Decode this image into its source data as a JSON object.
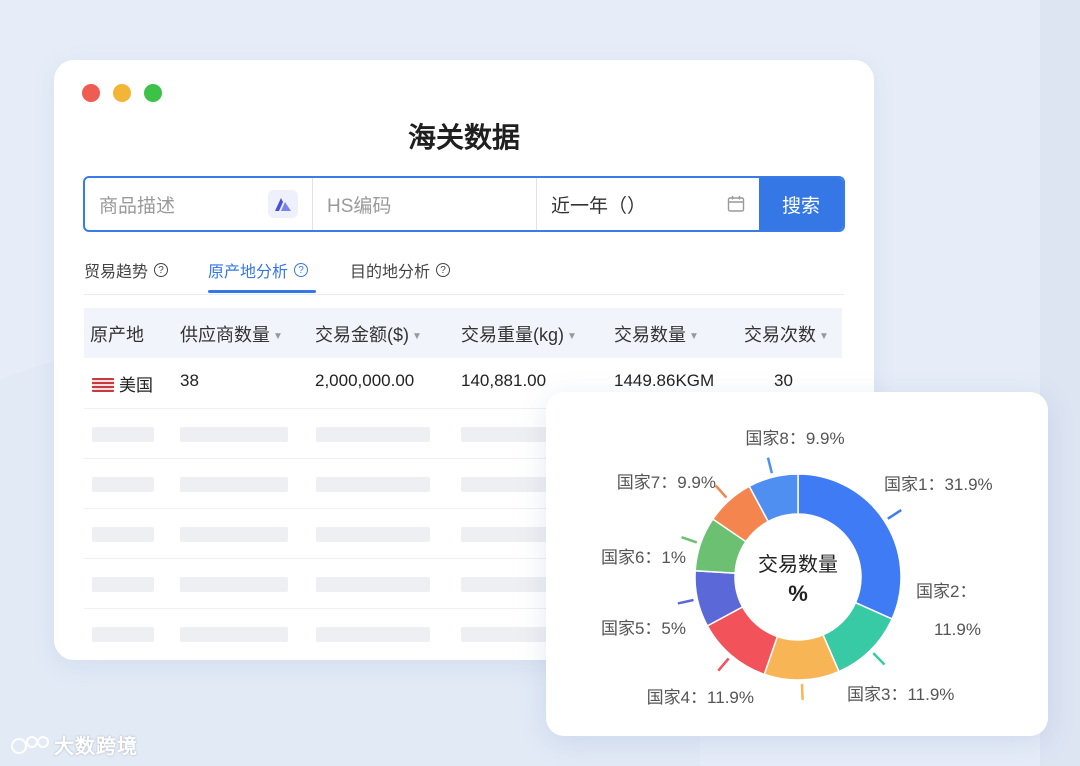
{
  "window": {
    "title": "海关数据"
  },
  "search": {
    "product_placeholder": "商品描述",
    "hs_placeholder": "HS编码",
    "date_range_value": "近一年（）",
    "button_label": "搜索"
  },
  "tabs": [
    {
      "label": "贸易趋势",
      "active": false
    },
    {
      "label": "原产地分析",
      "active": true
    },
    {
      "label": "目的地分析",
      "active": false
    }
  ],
  "table": {
    "columns": [
      "原产地",
      "供应商数量",
      "交易金额($)",
      "交易重量(kg)",
      "交易数量",
      "交易次数"
    ],
    "rows": [
      {
        "origin": "美国",
        "suppliers": "38",
        "amount": "2,000,000.00",
        "weight": "140,881.00",
        "quantity": "1449.86KGM",
        "count": "30"
      }
    ]
  },
  "chart_data": {
    "type": "pie",
    "center_label": "交易数量",
    "center_sublabel": "%",
    "slices": [
      {
        "label": "国家1：31.9%",
        "value": 31.9,
        "color": "#3e7bf5"
      },
      {
        "label_line1": "国家2：",
        "label_line2": "11.9%",
        "value": 11.9,
        "color": "#38c9a5"
      },
      {
        "label": "国家3：11.9%",
        "value": 11.9,
        "color": "#f7b555"
      },
      {
        "label": "国家4：11.9%",
        "value": 11.9,
        "color": "#f2535a"
      },
      {
        "label": "国家5：5%",
        "value": 8.9,
        "color": "#5b68d8"
      },
      {
        "label": "国家6：1%",
        "value": 8.6,
        "color": "#6cc071"
      },
      {
        "label": "国家7：9.9%",
        "value": 7.7,
        "color": "#f5854e"
      },
      {
        "label": "国家8：9.9%",
        "value": 7.9,
        "color": "#4f8ff2"
      }
    ]
  },
  "colors": {
    "accent": "#3477e5",
    "background": "#e4ebf7"
  },
  "watermark": "大数跨境"
}
